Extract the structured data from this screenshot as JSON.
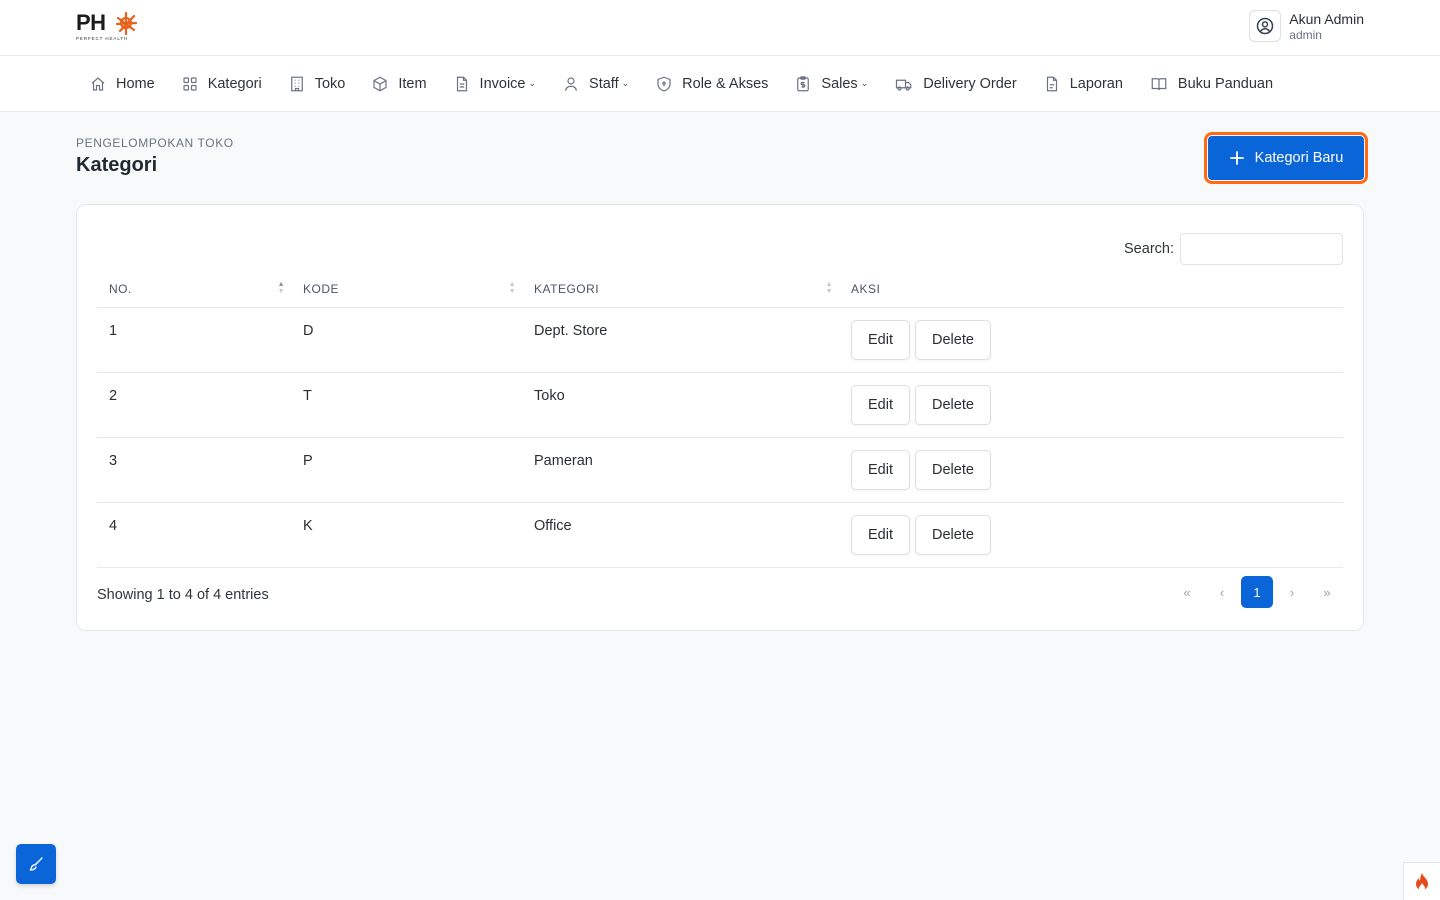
{
  "brand": {
    "logo_text": "PH",
    "tagline": "PERFECT HEALTH",
    "accent": "#e8621b"
  },
  "account": {
    "name": "Akun Admin",
    "role": "admin"
  },
  "nav": [
    {
      "label": "Home",
      "icon": "home-icon"
    },
    {
      "label": "Kategori",
      "icon": "grid-icon"
    },
    {
      "label": "Toko",
      "icon": "building-icon"
    },
    {
      "label": "Item",
      "icon": "box-icon"
    },
    {
      "label": "Invoice",
      "icon": "file-icon",
      "dropdown": true
    },
    {
      "label": "Staff",
      "icon": "user-icon",
      "dropdown": true
    },
    {
      "label": "Role & Akses",
      "icon": "shield-icon"
    },
    {
      "label": "Sales",
      "icon": "clipboard-dollar-icon",
      "dropdown": true
    },
    {
      "label": "Delivery Order",
      "icon": "truck-icon"
    },
    {
      "label": "Laporan",
      "icon": "document-icon"
    },
    {
      "label": "Buku Panduan",
      "icon": "book-icon"
    }
  ],
  "page": {
    "pretitle": "PENGELOMPOKAN TOKO",
    "title": "Kategori",
    "new_button": "Kategori Baru"
  },
  "table": {
    "search_label": "Search:",
    "search_value": "",
    "columns": [
      "NO.",
      "KODE",
      "KATEGORI",
      "AKSI"
    ],
    "rows": [
      {
        "no": "1",
        "kode": "D",
        "kategori": "Dept. Store"
      },
      {
        "no": "2",
        "kode": "T",
        "kategori": "Toko"
      },
      {
        "no": "3",
        "kode": "P",
        "kategori": "Pameran"
      },
      {
        "no": "4",
        "kode": "K",
        "kategori": "Office"
      }
    ],
    "edit_label": "Edit",
    "delete_label": "Delete",
    "info": "Showing 1 to 4 of 4 entries",
    "pager": {
      "first": "«",
      "prev": "‹",
      "current": "1",
      "next": "›",
      "last": "»"
    }
  },
  "colors": {
    "primary": "#0a66d8",
    "highlight": "#ff6a13"
  }
}
